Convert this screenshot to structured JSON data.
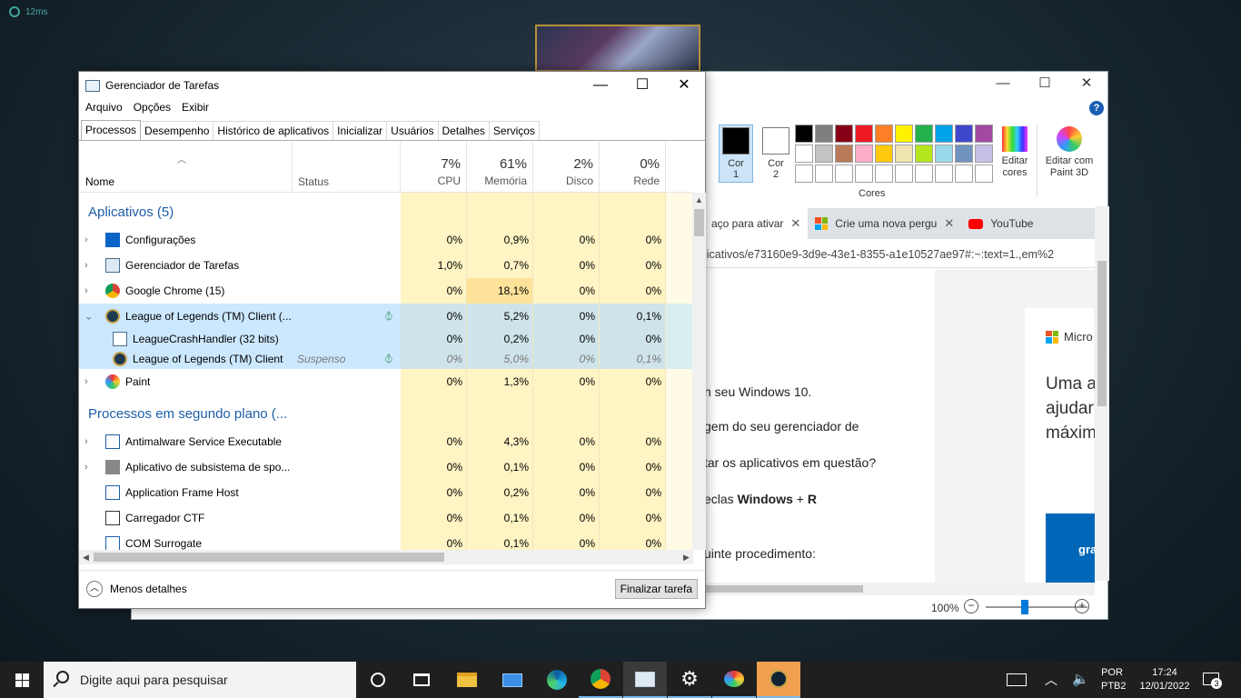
{
  "overlay": {
    "ping": "12ms"
  },
  "paint": {
    "cor1": "Cor\n1",
    "cor2": "Cor\n2",
    "cor1_color": "#000000",
    "cor2_color": "#ffffff",
    "palette": [
      "#000000",
      "#7f7f7f",
      "#880015",
      "#ed1c24",
      "#ff7f27",
      "#fff200",
      "#22b14c",
      "#00a2e8",
      "#3f48cc",
      "#a349a4",
      "#ffffff",
      "#c3c3c3",
      "#b97a57",
      "#ffaec9",
      "#ffc90e",
      "#efe4b0",
      "#b5e61d",
      "#99d9ea",
      "#7092be",
      "#c8bfe7",
      "#ffffff",
      "#ffffff",
      "#ffffff",
      "#ffffff",
      "#ffffff",
      "#ffffff",
      "#ffffff",
      "#ffffff",
      "#ffffff",
      "#ffffff"
    ],
    "cores_label": "Cores",
    "edit_colors": "Editar cores",
    "paint3d": "Editar com Paint 3D",
    "help": "?"
  },
  "browser": {
    "tabs": [
      {
        "label": "aço para ativar",
        "close": "✕"
      },
      {
        "label": "Crie uma nova pergu",
        "close": "✕"
      },
      {
        "label": "YouTube"
      }
    ],
    "url": "licativos/e73160e9-3d9e-43e1-8355-a1e10527ae97#:~:text=1.,em%2",
    "article": [
      "n seu Windows 10.",
      "gem do seu gerenciador de",
      "tar os aplicativos em questão?",
      "eclas ",
      "uinte procedimento:"
    ],
    "article_bold": "Windows",
    "article_plus": " + ",
    "article_bold2": "R",
    "side_brand": "Micro",
    "side_head": [
      "Uma a",
      "ajudar",
      "máxim"
    ],
    "side_btn": "gra",
    "zoom": "100%"
  },
  "taskmgr": {
    "title": "Gerenciador de Tarefas",
    "menu": [
      "Arquivo",
      "Opções",
      "Exibir"
    ],
    "tabs": [
      "Processos",
      "Desempenho",
      "Histórico de aplicativos",
      "Inicializar",
      "Usuários",
      "Detalhes",
      "Serviços"
    ],
    "cols": {
      "name": "Nome",
      "status": "Status",
      "cpu_pct": "7%",
      "cpu": "CPU",
      "mem_pct": "61%",
      "mem": "Memória",
      "disk_pct": "2%",
      "disk": "Disco",
      "net_pct": "0%",
      "net": "Rede"
    },
    "section_apps": "Aplicativos (5)",
    "section_bg": "Processos em segundo plano (...",
    "apps": [
      {
        "name": "Configurações",
        "cpu": "0%",
        "mem": "0,9%",
        "disk": "0%",
        "net": "0%"
      },
      {
        "name": "Gerenciador de Tarefas",
        "cpu": "1,0%",
        "mem": "0,7%",
        "disk": "0%",
        "net": "0%"
      },
      {
        "name": "Google Chrome (15)",
        "cpu": "0%",
        "mem": "18,1%",
        "disk": "0%",
        "net": "0%"
      },
      {
        "name": "League of Legends (TM) Client (...",
        "cpu": "0%",
        "mem": "5,2%",
        "disk": "0%",
        "net": "0,1%"
      },
      {
        "name": "LeagueCrashHandler (32 bits)",
        "cpu": "0%",
        "mem": "0,2%",
        "disk": "0%",
        "net": "0%"
      },
      {
        "name": "League of Legends (TM) Client",
        "status": "Suspenso",
        "cpu": "0%",
        "mem": "5,0%",
        "disk": "0%",
        "net": "0,1%"
      },
      {
        "name": "Paint",
        "cpu": "0%",
        "mem": "1,3%",
        "disk": "0%",
        "net": "0%"
      }
    ],
    "bg": [
      {
        "name": "Antimalware Service Executable",
        "cpu": "0%",
        "mem": "4,3%",
        "disk": "0%",
        "net": "0%"
      },
      {
        "name": "Aplicativo de subsistema de spo...",
        "cpu": "0%",
        "mem": "0,1%",
        "disk": "0%",
        "net": "0%"
      },
      {
        "name": "Application Frame Host",
        "cpu": "0%",
        "mem": "0,2%",
        "disk": "0%",
        "net": "0%"
      },
      {
        "name": "Carregador CTF",
        "cpu": "0%",
        "mem": "0,1%",
        "disk": "0%",
        "net": "0%"
      },
      {
        "name": "COM Surrogate",
        "cpu": "0%",
        "mem": "0,1%",
        "disk": "0%",
        "net": "0%"
      }
    ],
    "less_details": "Menos detalhes",
    "end_task": "Finalizar tarefa"
  },
  "taskbar": {
    "search_placeholder": "Digite aqui para pesquisar",
    "lang1": "POR",
    "lang2": "PTB2",
    "time": "17:24",
    "date": "12/01/2022",
    "notif_count": "3"
  }
}
